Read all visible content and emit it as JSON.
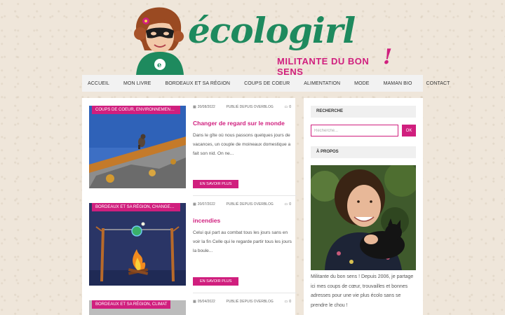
{
  "header": {
    "brand": "écologirl",
    "tagline": "MILITANTE DU BON SENS",
    "exclamation": "!",
    "mascot_icon": "superhero-girl-mask-icon"
  },
  "nav": {
    "items": [
      "ACCUEIL",
      "MON LIVRE",
      "BORDEAUX ET SA RÉGION",
      "COUPS DE COEUR",
      "ALIMENTATION",
      "MODE",
      "MAMAN BIO",
      "CONTACT"
    ]
  },
  "posts": [
    {
      "category": "COUPS DE COEUR, ENVIRONNEMENT, N...",
      "date": "20/08/2022",
      "source": "PUBLIÉ DEPUIS OVERBLOG",
      "comments": "0",
      "title": "Changer de regard sur le monde",
      "excerpt": "Dans le gîte où nous passons quelques jours de vacances, un couple de moineaux domestique a fait son nid. On ne...",
      "button": "EN SAVOIR PLUS"
    },
    {
      "category": "BORDEAUX ET SA RÉGION, CHANGEMEN...",
      "date": "20/07/2022",
      "source": "PUBLIÉ DEPUIS OVERBLOG",
      "comments": "0",
      "title": "incendies",
      "excerpt": "Celui qui part au combat tous les jours sans en voir la fin Celle qui le regarde partir tous les jours la boule...",
      "button": "EN SAVOIR PLUS"
    },
    {
      "category": "BORDEAUX ET SA RÉGION, CLIMAT",
      "date": "05/04/2022",
      "source": "PUBLIÉ DEPUIS OVERBLOG",
      "comments": "0"
    }
  ],
  "sidebar": {
    "search_title": "RECHERCHE",
    "search_placeholder": "Recherche...",
    "search_button": "OK",
    "about_title": "À PROPOS",
    "about_text": "Militante du bon sens ! Depuis 2006, je partage ici mes coups de cœur, trouvailles et bonnes adresses pour une vie plus écolo sans se prendre le chou !"
  },
  "colors": {
    "accent": "#d01f7e",
    "brand_green": "#1e8a5e",
    "background": "#efe6da"
  },
  "icons": {
    "calendar": "calendar-icon",
    "comment": "comment-icon"
  }
}
